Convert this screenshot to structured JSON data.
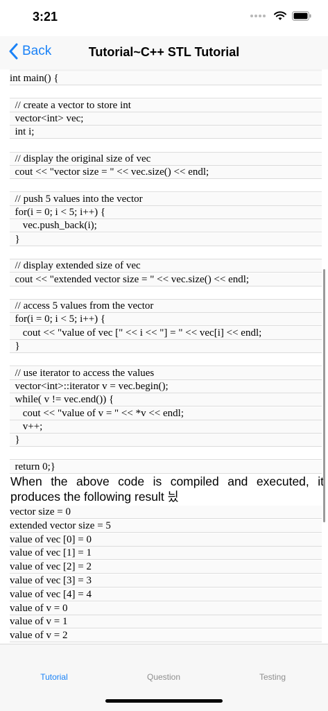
{
  "status_bar": {
    "time": "3:21"
  },
  "nav": {
    "back_label": "Back",
    "title": "Tutorial~C++ STL Tutorial"
  },
  "code_lines": [
    "int main() {",
    "",
    "  // create a vector to store int",
    "  vector<int> vec;",
    "  int i;",
    "",
    "  // display the original size of vec",
    "  cout << \"vector size = \" << vec.size() << endl;",
    "",
    "  // push 5 values into the vector",
    "  for(i = 0; i < 5; i++) {",
    "     vec.push_back(i);",
    "  }",
    "",
    "  // display extended size of vec",
    "  cout << \"extended vector size = \" << vec.size() << endl;",
    "",
    "  // access 5 values from the vector",
    "  for(i = 0; i < 5; i++) {",
    "     cout << \"value of vec [\" << i << \"] = \" << vec[i] << endl;",
    "  }",
    "",
    "  // use iterator to access the values",
    "  vector<int>::iterator v = vec.begin();",
    "  while( v != vec.end()) {",
    "     cout << \"value of v = \" << *v << endl;",
    "     v++;",
    "  }",
    "",
    "  return 0;}"
  ],
  "description": "When the above code is compiled and executed, it produces the following result 닀",
  "output_lines": [
    "vector size = 0",
    "extended vector size = 5",
    "value of vec [0] = 0",
    "value of vec [1] = 1",
    "value of vec [2] = 2",
    "value of vec [3] = 3",
    "value of vec [4] = 4",
    "value of v = 0",
    "value of v = 1",
    "value of v = 2"
  ],
  "tabs": [
    {
      "label": "Tutorial",
      "active": true
    },
    {
      "label": "Question",
      "active": false
    },
    {
      "label": "Testing",
      "active": false
    }
  ],
  "colors": {
    "accent": "#1a82f7",
    "inactive_tab": "#8e8e8e"
  }
}
